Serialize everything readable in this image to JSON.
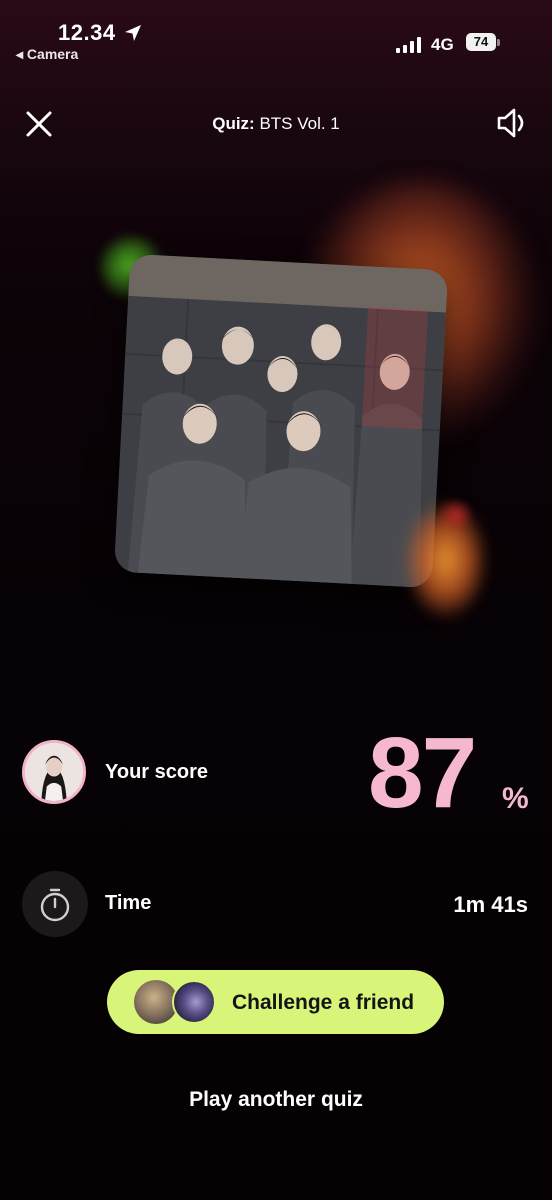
{
  "status_bar": {
    "time": "12.34",
    "back_app": "◂ Camera",
    "network": "4G",
    "battery": "74"
  },
  "header": {
    "title_prefix": "Quiz:",
    "title_name": " BTS Vol. 1"
  },
  "result": {
    "score_label": "Your score",
    "score_value": "87",
    "score_unit": "%",
    "time_label": "Time",
    "time_value": "1m 41s"
  },
  "actions": {
    "challenge_label": "Challenge a friend",
    "play_another_label": "Play another quiz"
  },
  "colors": {
    "accent_pink": "#f6b8d1",
    "challenge_green": "#d8f57a"
  },
  "icons": [
    "location-arrow-icon",
    "signal-icon",
    "battery-icon",
    "close-icon",
    "speaker-icon",
    "stopwatch-icon"
  ]
}
